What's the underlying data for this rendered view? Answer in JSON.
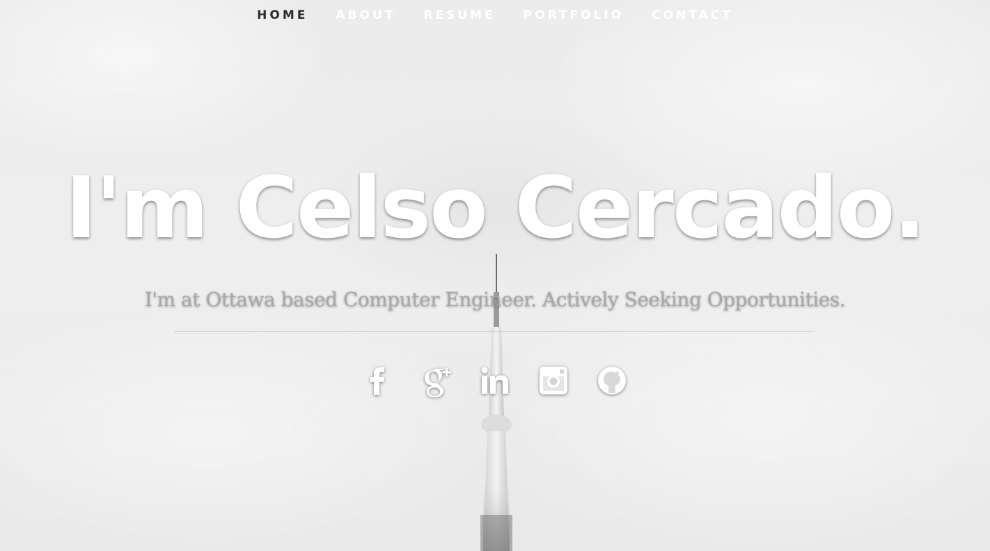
{
  "nav": {
    "items": [
      {
        "label": "HOME",
        "active": true
      },
      {
        "label": "ABOUT",
        "active": false
      },
      {
        "label": "RESUME",
        "active": false
      },
      {
        "label": "PORTFOLIO",
        "active": false
      },
      {
        "label": "CONTACT",
        "active": false
      }
    ]
  },
  "hero": {
    "title": "I'm Celso Cercado.",
    "subtitle": "I'm at Ottawa based Computer Engineer. Actively Seeking Opportunities."
  },
  "social": {
    "icons": [
      "facebook-icon",
      "google-plus-icon",
      "linkedin-icon",
      "instagram-icon",
      "github-icon"
    ]
  },
  "colors": {
    "nav_active": "#2b2b2b",
    "nav_inactive": "#ffffff",
    "title": "#ffffff",
    "subtitle": "#a8a8a8",
    "background": "#ededed"
  }
}
